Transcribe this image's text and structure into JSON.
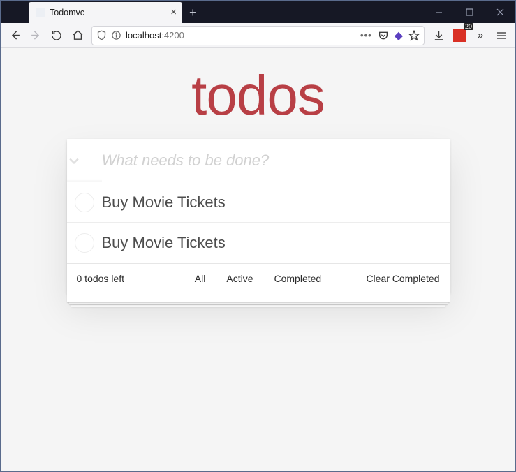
{
  "browser": {
    "tab_title": "Todomvc",
    "url_host": "localhost",
    "url_port": ":4200",
    "extension_badge": "20"
  },
  "app": {
    "title": "todos",
    "input_placeholder": "What needs to be done?",
    "items": [
      {
        "label": "Buy Movie Tickets",
        "completed": false
      },
      {
        "label": "Buy Movie Tickets",
        "completed": false
      }
    ],
    "footer": {
      "count_text": "0 todos left",
      "filters": {
        "all": "All",
        "active": "Active",
        "completed": "Completed"
      },
      "clear": "Clear Completed"
    }
  }
}
